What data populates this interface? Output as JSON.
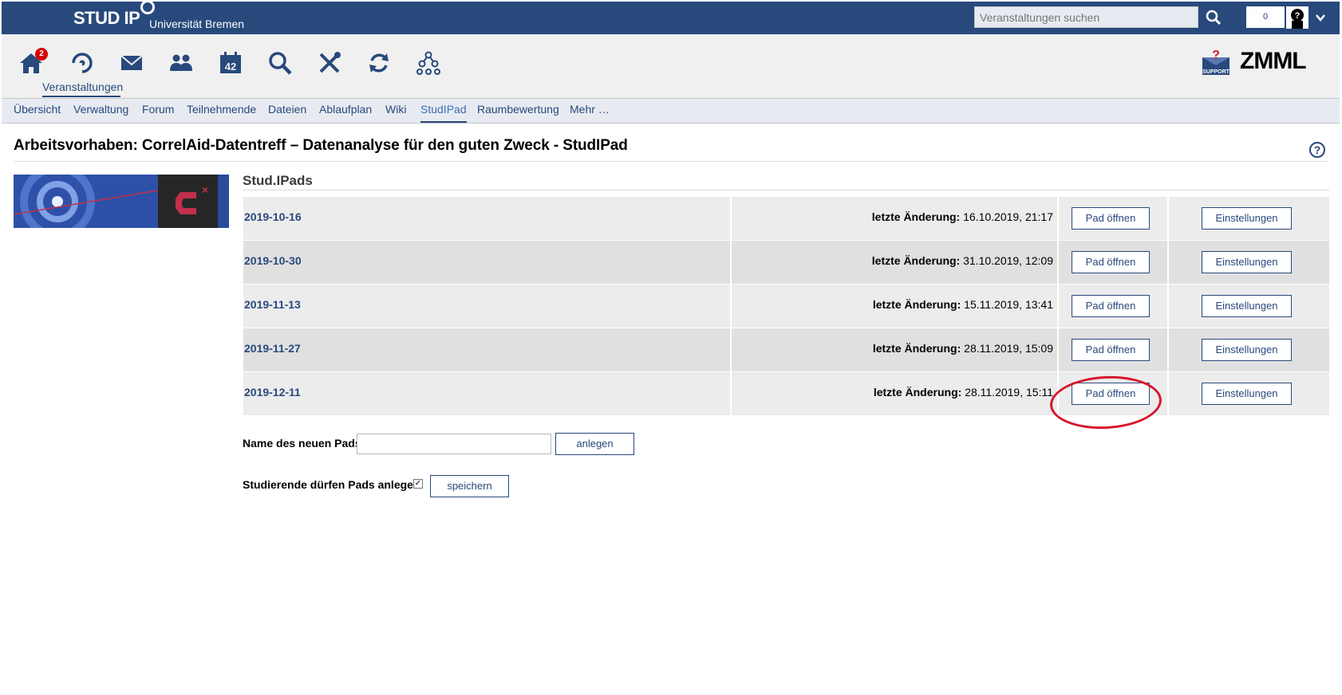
{
  "header": {
    "logo_text": "STUD IP",
    "university": "Universität Bremen",
    "search_placeholder": "Veranstaltungen suchen",
    "notification_count": "0"
  },
  "nav": {
    "home_badge": "2",
    "active_label": "Veranstaltungen",
    "zmml_logo": "ZMML"
  },
  "tabs": [
    "Übersicht",
    "Verwaltung",
    "Forum",
    "Teilnehmende",
    "Dateien",
    "Ablaufplan",
    "Wiki",
    "StudIPad",
    "Raumbewertung",
    "Mehr …"
  ],
  "active_tab": "StudIPad",
  "page": {
    "title": "Arbeitsvorhaben: CorrelAid-Datentreff – Datenanalyse für den guten Zweck - StudIPad",
    "help": "?"
  },
  "pads": {
    "section_title": "Stud.IPads",
    "changed_label": "letzte Änderung:",
    "open_label": "Pad öffnen",
    "settings_label": "Einstellungen",
    "rows": [
      {
        "name": "2019-10-16",
        "changed": "16.10.2019, 21:17"
      },
      {
        "name": "2019-10-30",
        "changed": "31.10.2019, 12:09"
      },
      {
        "name": "2019-11-13",
        "changed": "15.11.2019, 13:41"
      },
      {
        "name": "2019-11-27",
        "changed": "28.11.2019, 15:09"
      },
      {
        "name": "2019-12-11",
        "changed": "28.11.2019, 15:11"
      }
    ]
  },
  "form": {
    "new_pad_label": "Name des neuen Pads:",
    "new_pad_value": "",
    "create_label": "anlegen",
    "students_label": "Studierende dürfen Pads anlegen:",
    "students_checked": true,
    "save_label": "speichern"
  }
}
